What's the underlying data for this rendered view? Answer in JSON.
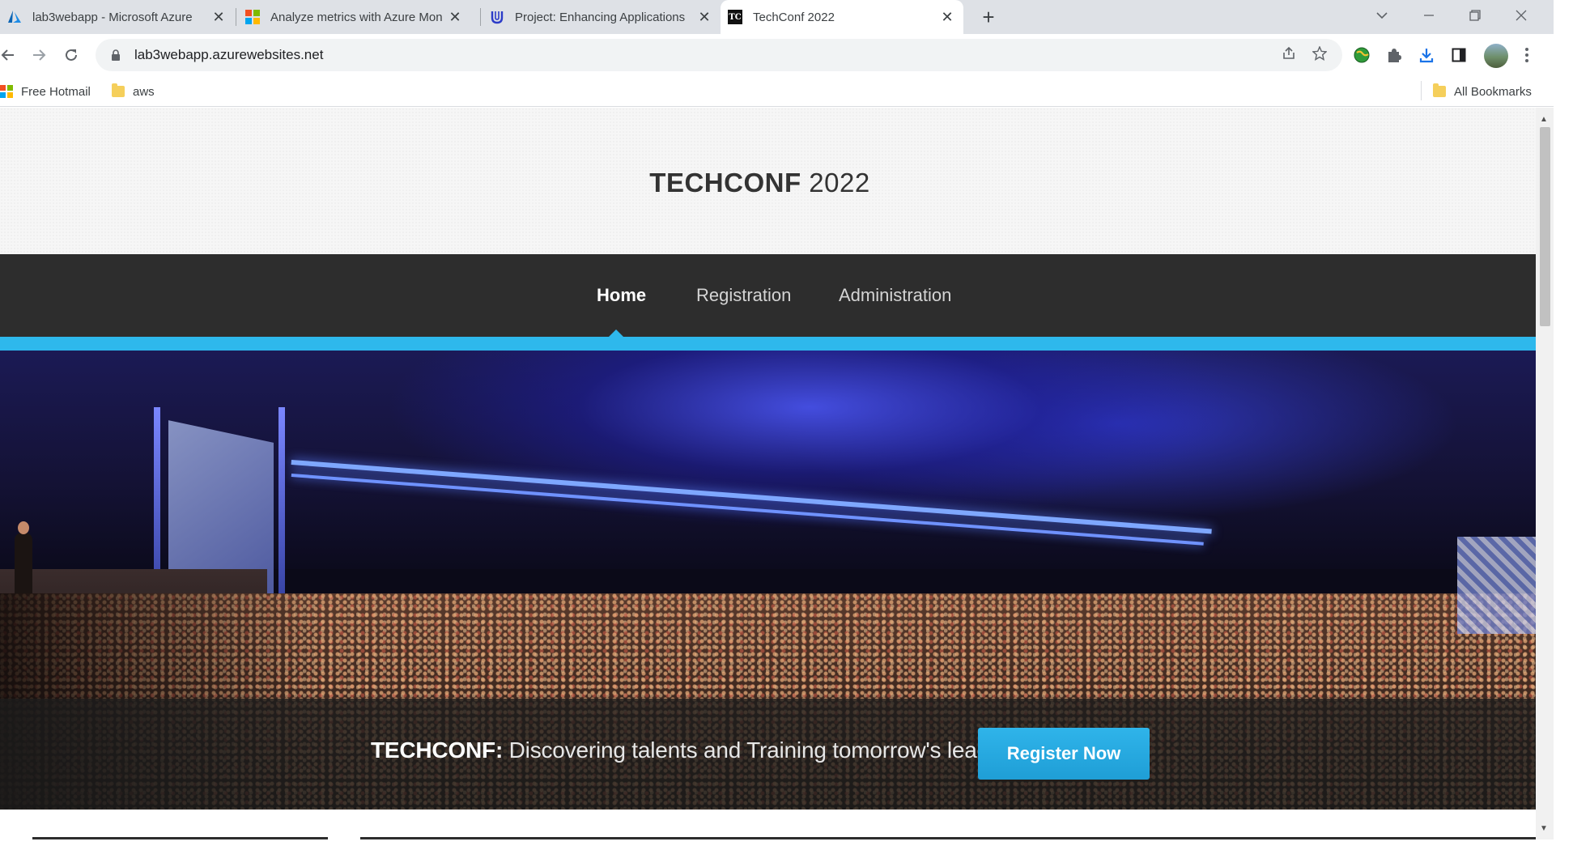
{
  "browser": {
    "tabs": [
      {
        "title": "lab3webapp - Microsoft Azure",
        "icon": "azure-icon"
      },
      {
        "title": "Analyze metrics with Azure Mon",
        "icon": "microsoft-icon"
      },
      {
        "title": "Project: Enhancing Applications",
        "icon": "udacity-icon"
      },
      {
        "title": "TechConf 2022",
        "icon": "techconf-icon",
        "active": true
      }
    ],
    "new_tab_label": "+",
    "close_glyph": "✕",
    "url": "lab3webapp.azurewebsites.net",
    "bookmarks": [
      {
        "label": "Free Hotmail",
        "icon": "microsoft-icon"
      },
      {
        "label": "aws",
        "icon": "folder-icon"
      }
    ],
    "all_bookmarks_label": "All Bookmarks",
    "techconf_icon_text": "TC"
  },
  "site": {
    "logo_bold": "TECHCONF",
    "logo_light": " 2022",
    "nav": [
      {
        "label": "Home",
        "active": true
      },
      {
        "label": "Registration"
      },
      {
        "label": "Administration"
      }
    ],
    "hero": {
      "tagline_bold": "TECHCONF:",
      "tagline_rest": " Discovering talents and Training tomorrow's leaders",
      "register_label": "Register Now"
    }
  },
  "colors": {
    "accent": "#2eb8ec",
    "nav_bg": "#2d2d2d",
    "header_bg": "#f6f6f6",
    "button": "#1f9ed6"
  }
}
